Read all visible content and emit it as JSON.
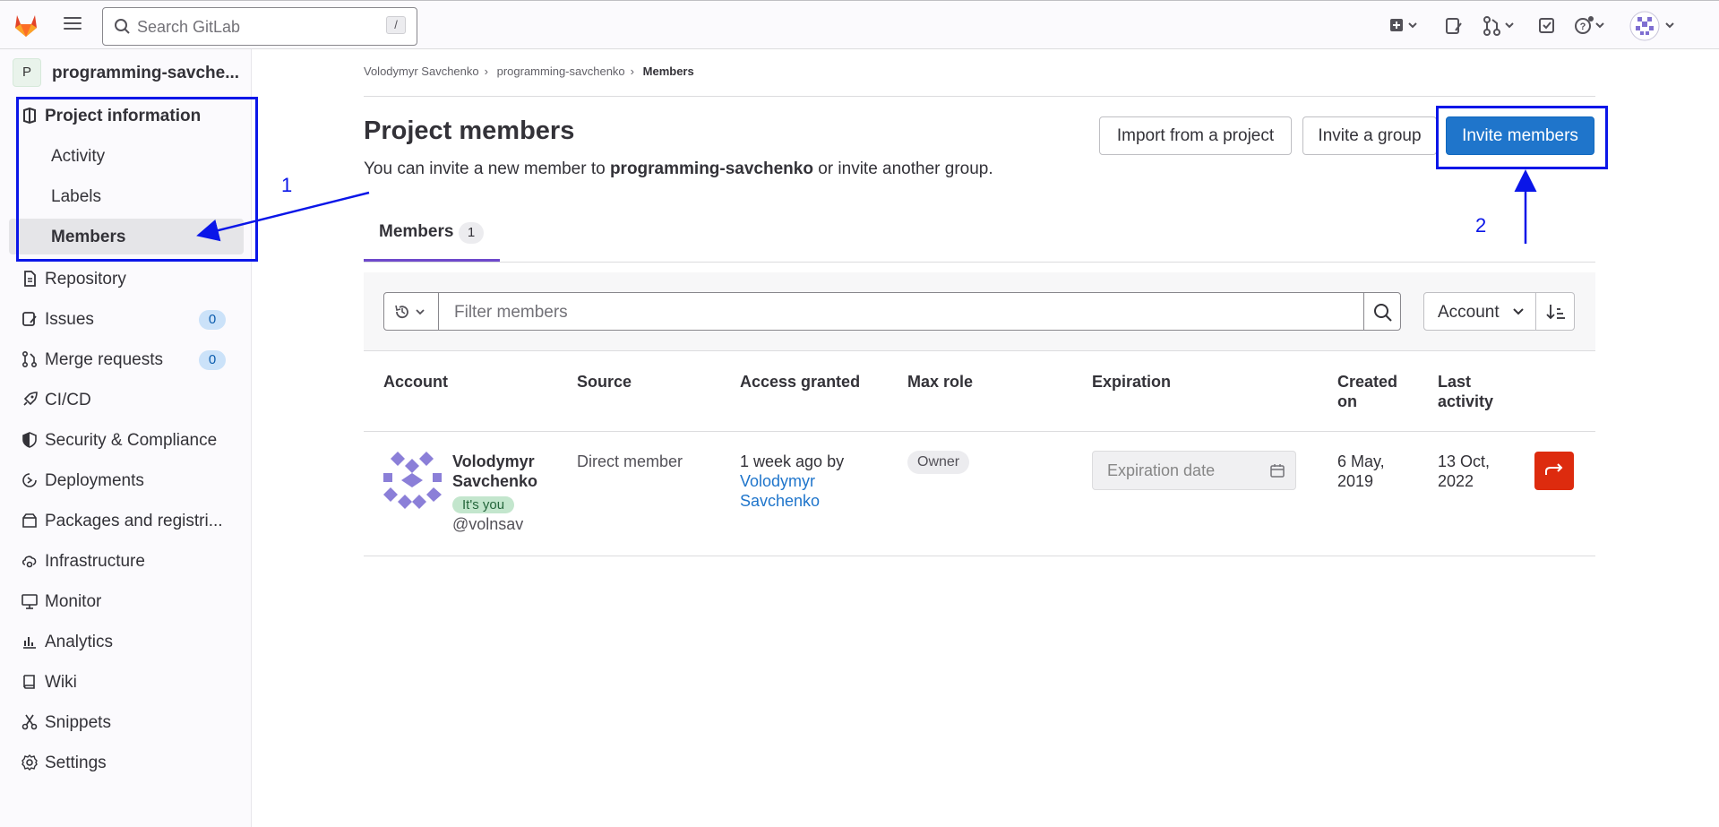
{
  "topbar": {
    "search_placeholder": "Search GitLab",
    "search_shortcut": "/",
    "icons": [
      "gitlab-logo",
      "hamburger-menu-icon",
      "plus-square-icon",
      "issues-icon",
      "merge-request-icon",
      "todo-icon",
      "help-icon",
      "user-avatar"
    ]
  },
  "sidebar": {
    "project_initial": "P",
    "project_name": "programming-savche...",
    "project_information": "Project information",
    "sub_items": [
      "Activity",
      "Labels",
      "Members"
    ],
    "items": [
      {
        "label": "Repository",
        "icon": "document-icon"
      },
      {
        "label": "Issues",
        "icon": "issues-icon",
        "badge": "0"
      },
      {
        "label": "Merge requests",
        "icon": "merge-request-icon",
        "badge": "0"
      },
      {
        "label": "CI/CD",
        "icon": "rocket-icon"
      },
      {
        "label": "Security & Compliance",
        "icon": "shield-icon"
      },
      {
        "label": "Deployments",
        "icon": "deployments-icon"
      },
      {
        "label": "Packages and registri...",
        "icon": "package-icon"
      },
      {
        "label": "Infrastructure",
        "icon": "cloud-gear-icon"
      },
      {
        "label": "Monitor",
        "icon": "monitor-icon"
      },
      {
        "label": "Analytics",
        "icon": "chart-icon"
      },
      {
        "label": "Wiki",
        "icon": "book-icon"
      },
      {
        "label": "Snippets",
        "icon": "scissors-icon"
      },
      {
        "label": "Settings",
        "icon": "gear-icon"
      }
    ]
  },
  "breadcrumb": {
    "items": [
      "Volodymyr Savchenko",
      "programming-savchenko",
      "Members"
    ]
  },
  "main": {
    "title": "Project members",
    "desc_before": "You can invite a new member to ",
    "desc_project": "programming-savchenko",
    "desc_after": " or invite another group.",
    "btn_import": "Import from a project",
    "btn_invite_group": "Invite a group",
    "btn_invite_members": "Invite members",
    "tab_label": "Members",
    "tab_count": "1",
    "filter_placeholder": "Filter members",
    "sort_label": "Account"
  },
  "table": {
    "headers": {
      "account": "Account",
      "source": "Source",
      "access": "Access granted",
      "maxrole": "Max role",
      "expiration": "Expiration",
      "created1": "Created",
      "created2": "on",
      "last1": "Last",
      "last2": "activity"
    },
    "row": {
      "name1": "Volodymyr",
      "name2": "Savchenko",
      "badge": "It's you",
      "username": "@volnsav",
      "source": "Direct member",
      "access_prefix": "1 week ago by",
      "access_by1": "Volodymyr",
      "access_by2": "Savchenko",
      "role": "Owner",
      "expiry_placeholder": "Expiration date",
      "created1": "6 May,",
      "created2": "2019",
      "last1": "13 Oct,",
      "last2": "2022"
    }
  },
  "annotations": {
    "num1": "1",
    "num2": "2",
    "color": "#0a16e8"
  }
}
